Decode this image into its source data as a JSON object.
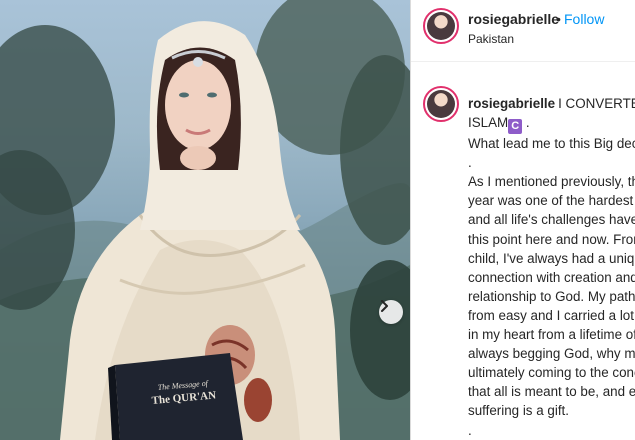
{
  "post": {
    "username": "rosiegabrielle",
    "separator": "•",
    "follow_label": "Follow",
    "location": "Pakistan"
  },
  "photo": {
    "book_line1": "The Message of",
    "book_line2": "The QUR'AN"
  },
  "caption": {
    "username": "rosiegabrielle",
    "line1_text": "I CONVERTED to",
    "line2_text": "ISLAM",
    "emoji_glyph": "C",
    "line2_tail": " .",
    "lines": [
      "What lead me to this Big decisio",
      ".",
      "As I mentioned previously, this",
      "year was one of the hardest in r",
      "and all life's challenges have led",
      "this point here and now. From a",
      "child, I've always had a unique",
      "connection with creation and sp",
      "relationship to God. My path w",
      "from easy and I carried a lot of",
      "in my heart from a lifetime of pa",
      "always begging God, why me? U",
      "ultimately coming to the conclu",
      "that all is meant to be, and ever",
      "suffering is a gift.",
      "."
    ]
  },
  "icons": {
    "next": "chevron-right-icon"
  },
  "colors": {
    "follow": "#0095f6",
    "text": "#262626",
    "story_ring": "#e1306c",
    "emoji_bg": "#8e5cc9"
  }
}
